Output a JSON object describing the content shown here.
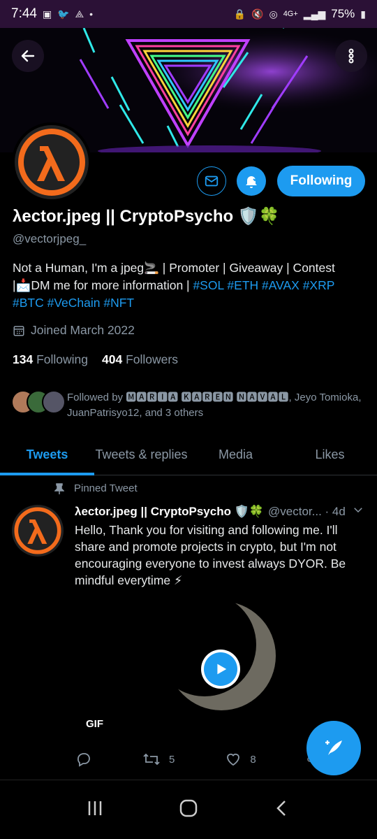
{
  "status_bar": {
    "time": "7:44",
    "network": "4G+",
    "battery": "75%"
  },
  "profile": {
    "display_name": "λector.jpeg || CryptoPsycho 🛡️🍀",
    "handle": "@vectorjpeg_",
    "following_button": "Following",
    "bio_line1": "Not a Human, I'm a jpeg🚬 | Promoter | Giveaway | Contest",
    "bio_line2_prefix": "|📩DM me for more information | ",
    "bio_tags_line2": "#SOL #ETH #AVAX #XRP",
    "bio_tags_line3": "#BTC #VeChain #NFT",
    "joined": "Joined March 2022",
    "following_count": "134",
    "following_label": "Following",
    "followers_count": "404",
    "followers_label": "Followers",
    "followed_by": "Followed by 🅼🅰🆁🅸🅰 🅺🅰🆁🅴🅽 🅽🅰🆅🅰🅻, Jeyo Tomioka, JuanPatrisyo12, and 3 others"
  },
  "tabs": [
    {
      "label": "Tweets"
    },
    {
      "label": "Tweets & replies"
    },
    {
      "label": "Media"
    },
    {
      "label": "Likes"
    }
  ],
  "tweet": {
    "pinned_label": "Pinned Tweet",
    "author": "λector.jpeg || CryptoPsycho 🛡️🍀",
    "handle_time": "@vector... · 4d",
    "text": "Hello, Thank you for visiting and following me. I'll share and promote projects in crypto, but I'm not encouraging everyone to invest always DYOR. Be mindful everytime ⚡",
    "media_badge": "GIF",
    "retweets": "5",
    "likes": "8"
  },
  "colors": {
    "accent": "#1d9bf0",
    "status_bar": "#2b1136",
    "logo_orange": "#f36b1c"
  },
  "icons": [
    "back-arrow-icon",
    "more-vertical-icon",
    "mail-icon",
    "bell-icon",
    "calendar-icon",
    "pin-icon",
    "chevron-down-icon",
    "play-icon",
    "reply-icon",
    "retweet-icon",
    "heart-icon",
    "share-icon",
    "compose-tweet-icon",
    "recents-icon",
    "home-icon",
    "back-icon"
  ]
}
